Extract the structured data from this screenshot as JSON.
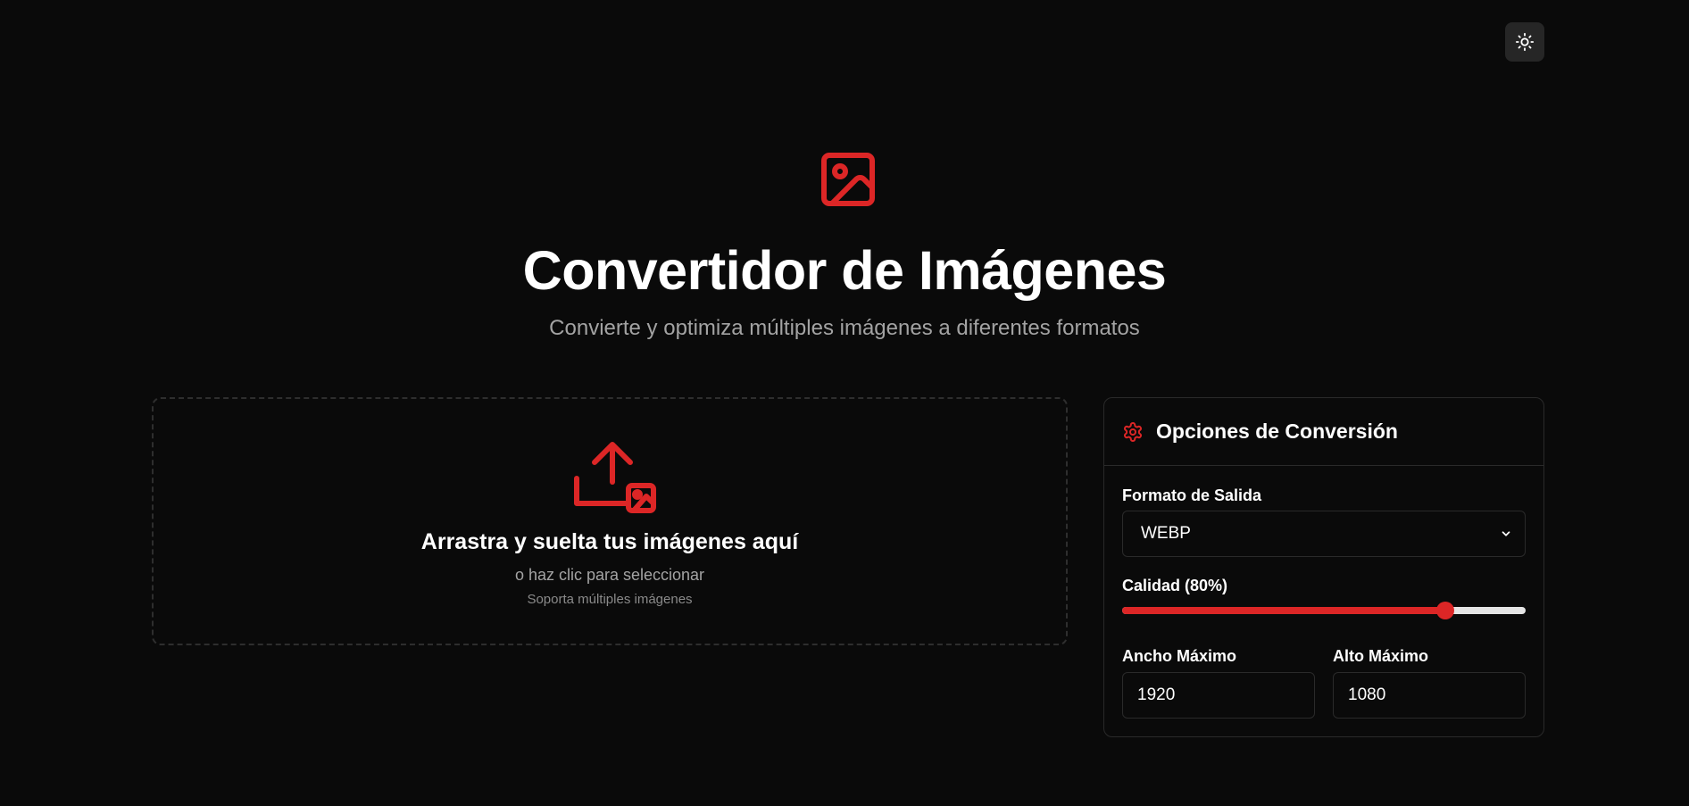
{
  "colors": {
    "accent": "#dc2626",
    "background": "#0a0a0a",
    "border": "#2a2a2a"
  },
  "header": {
    "theme_toggle_icon": "sun-icon"
  },
  "hero": {
    "icon": "image-icon",
    "title": "Convertidor de Imágenes",
    "subtitle": "Convierte y optimiza múltiples imágenes a diferentes formatos"
  },
  "dropzone": {
    "icon": "upload-image-icon",
    "title": "Arrastra y suelta tus imágenes aquí",
    "subtitle": "o haz clic para seleccionar",
    "note": "Soporta múltiples imágenes"
  },
  "options": {
    "icon": "gear-icon",
    "title": "Opciones de Conversión",
    "format": {
      "label": "Formato de Salida",
      "value": "WEBP"
    },
    "quality": {
      "label": "Calidad (80%)",
      "value": 0.8
    },
    "max_width": {
      "label": "Ancho Máximo",
      "value": "1920"
    },
    "max_height": {
      "label": "Alto Máximo",
      "value": "1080"
    }
  }
}
